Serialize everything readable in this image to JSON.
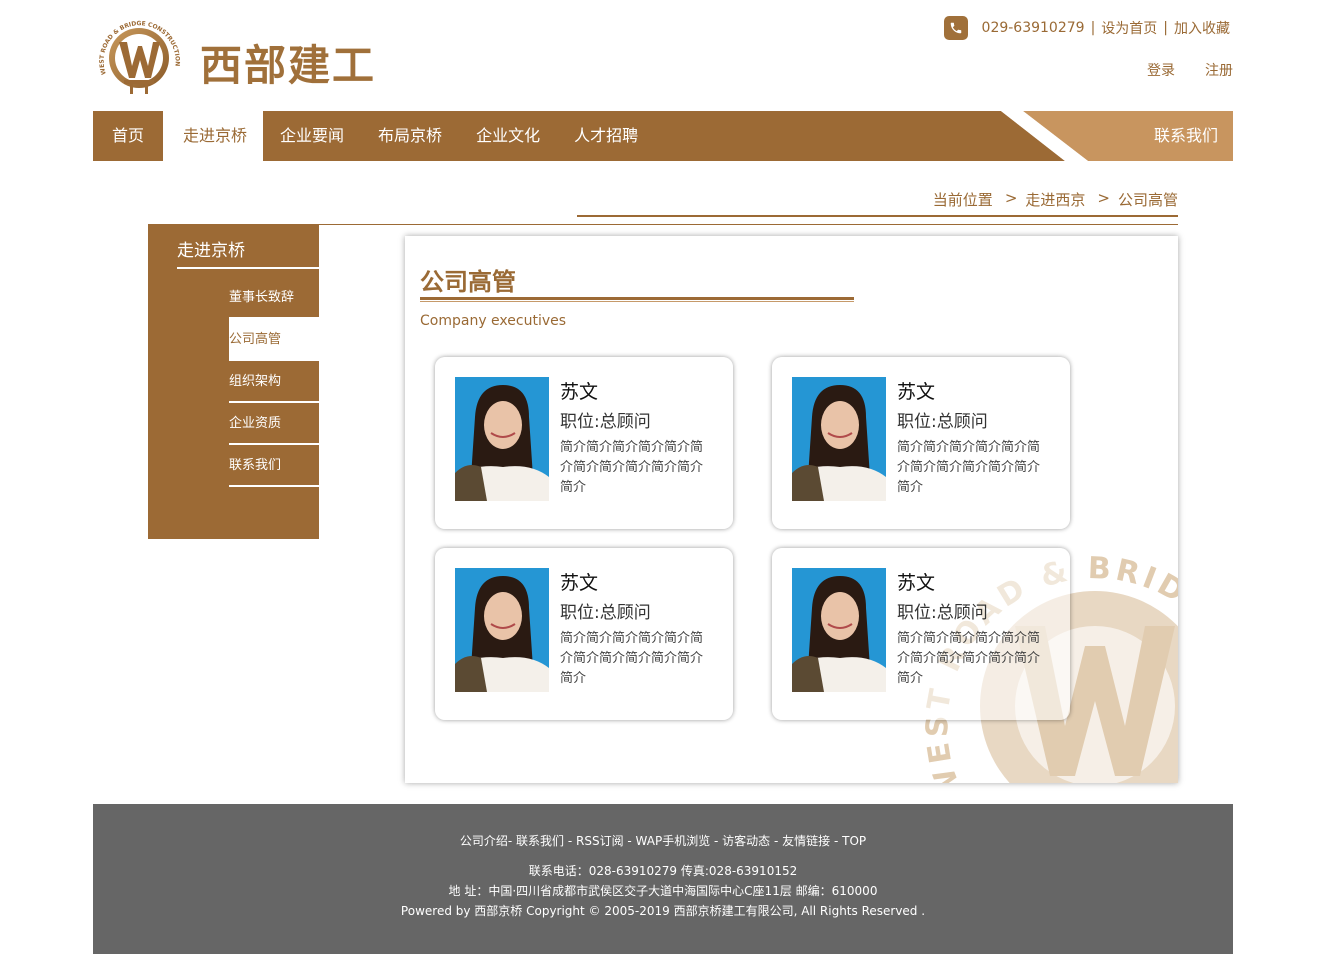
{
  "header": {
    "brand_name": "西部建工",
    "logo_ring_text": "WEST ROAD & BRIDGE CONSTRUCTION",
    "phone": "029-63910279",
    "set_home": "设为首页",
    "bookmark": "加入收藏",
    "login": "登录",
    "register": "注册"
  },
  "nav": {
    "items": [
      {
        "label": "首页"
      },
      {
        "label": "走进京桥"
      },
      {
        "label": "企业要闻"
      },
      {
        "label": "布局京桥"
      },
      {
        "label": "企业文化"
      },
      {
        "label": "人才招聘"
      }
    ],
    "contact": "联系我们"
  },
  "breadcrumb": {
    "current": "当前位置",
    "level1": "走进西京",
    "level2": "公司高管"
  },
  "sidebar": {
    "title": "走进京桥",
    "items": [
      {
        "label": "董事长致辞"
      },
      {
        "label": "公司高管"
      },
      {
        "label": "组织架构"
      },
      {
        "label": "企业资质"
      },
      {
        "label": "联系我们"
      }
    ]
  },
  "content": {
    "title": "公司高管",
    "subtitle": "Company executives",
    "cards": [
      {
        "name": "苏文",
        "role": "职位:总顾问",
        "desc": "简介简介简介简介简介简介简介简介简介简介简介简介"
      },
      {
        "name": "苏文",
        "role": "职位:总顾问",
        "desc": "简介简介简介简介简介简介简介简介简介简介简介简介"
      },
      {
        "name": "苏文",
        "role": "职位:总顾问",
        "desc": "简介简介简介简介简介简介简介简介简介简介简介简介"
      },
      {
        "name": "苏文",
        "role": "职位:总顾问",
        "desc": "简介简介简介简介简介简介简介简介简介简介简介简介"
      }
    ]
  },
  "footer": {
    "links": [
      "公司介绍",
      "联系我们",
      "RSS订阅",
      "WAP手机浏览",
      "访客动态",
      "友情链接",
      "TOP"
    ],
    "phone_line": "联系电话：028-63910279 传真:028-63910152",
    "address_line": "地 址：中国·四川省成都市武侯区交子大道中海国际中心C座11层 邮编：610000",
    "copyright_line": "Powered by 西部京桥 Copyright © 2005-2019 西部京桥建工有限公司, All Rights Reserved ."
  },
  "colors": {
    "brand": "#9c6a35",
    "brand_light": "#c8955f",
    "footer_bg": "#666666",
    "photo_bg": "#2596d4"
  }
}
